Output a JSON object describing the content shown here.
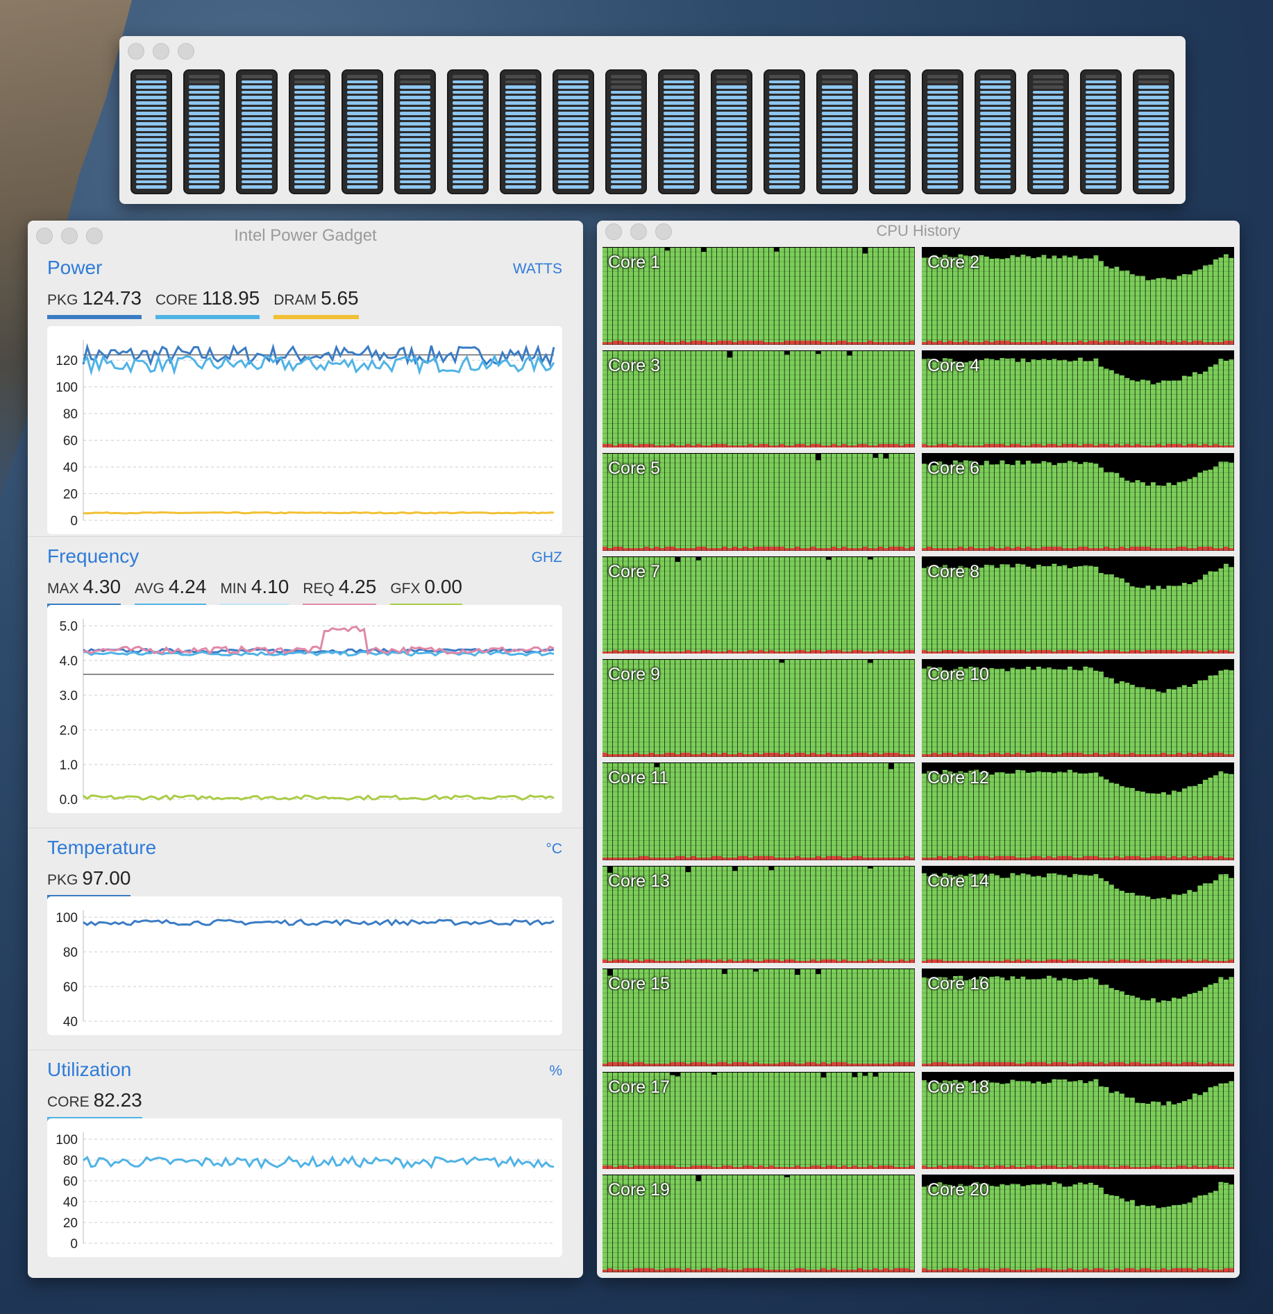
{
  "meter_window": {
    "core_count": 20,
    "levels": [
      0.97,
      0.92,
      0.97,
      0.92,
      0.97,
      0.92,
      0.97,
      0.92,
      0.97,
      0.88,
      0.97,
      0.92,
      0.97,
      0.92,
      0.97,
      0.92,
      0.97,
      0.88,
      0.97,
      0.92
    ],
    "on_color": "#8ec6f0",
    "off_color": "#4a4a4a"
  },
  "power_gadget": {
    "title": "Intel Power Gadget",
    "power": {
      "title": "Power",
      "unit": "WATTS",
      "metrics": [
        {
          "key": "PKG",
          "value": "124.73",
          "color": "#3a7cc4"
        },
        {
          "key": "CORE",
          "value": "118.95",
          "color": "#4fb3e6"
        },
        {
          "key": "DRAM",
          "value": "5.65",
          "color": "#f2c034"
        }
      ],
      "chart_data": {
        "type": "line",
        "yticks": [
          "120",
          "100",
          "80",
          "60",
          "40",
          "20",
          "0"
        ],
        "ylim": [
          0,
          130
        ],
        "ref_line": 124,
        "series": [
          {
            "key": "PKG",
            "color": "#3a7cc4",
            "base": 124,
            "jitter": 7
          },
          {
            "key": "CORE",
            "color": "#4fb3e6",
            "base": 117,
            "jitter": 6
          },
          {
            "key": "DRAM",
            "color": "#f2c034",
            "base": 5.6,
            "jitter": 0.4
          }
        ]
      }
    },
    "frequency": {
      "title": "Frequency",
      "unit": "GHZ",
      "metrics": [
        {
          "key": "MAX",
          "value": "4.30",
          "color": "#3a7cc4"
        },
        {
          "key": "AVG",
          "value": "4.24",
          "color": "#4fb3e6"
        },
        {
          "key": "MIN",
          "value": "4.10",
          "color": "#bfe3f5"
        },
        {
          "key": "REQ",
          "value": "4.25",
          "color": "#e088a8"
        },
        {
          "key": "GFX",
          "value": "0.00",
          "color": "#a9cc45"
        }
      ],
      "chart_data": {
        "type": "line",
        "yticks": [
          "5.0",
          "4.0",
          "3.0",
          "2.0",
          "1.0",
          "0.0"
        ],
        "ylim": [
          0,
          5
        ],
        "ref_line": 3.6,
        "series": [
          {
            "key": "MAX",
            "color": "#3a7cc4",
            "base": 4.28,
            "jitter": 0.05
          },
          {
            "key": "AVG",
            "color": "#4fb3e6",
            "base": 4.2,
            "jitter": 0.06
          },
          {
            "key": "REQ",
            "color": "#e088a8",
            "base": 4.3,
            "jitter": 0.1
          },
          {
            "key": "GFX",
            "color": "#a9cc45",
            "base": 0.05,
            "jitter": 0.06
          }
        ]
      }
    },
    "temperature": {
      "title": "Temperature",
      "unit": "°C",
      "metrics": [
        {
          "key": "PKG",
          "value": "97.00",
          "color": "#3a7cc4"
        }
      ],
      "chart_data": {
        "type": "line",
        "yticks": [
          "100",
          "80",
          "60",
          "40"
        ],
        "ylim": [
          40,
          100
        ],
        "series": [
          {
            "key": "PKG",
            "color": "#3a7cc4",
            "base": 97,
            "jitter": 1.5
          }
        ]
      }
    },
    "utilization": {
      "title": "Utilization",
      "unit": "%",
      "metrics": [
        {
          "key": "CORE",
          "value": "82.23",
          "color": "#4fb3e6"
        }
      ],
      "chart_data": {
        "type": "line",
        "yticks": [
          "100",
          "80",
          "60",
          "40",
          "20",
          "0"
        ],
        "ylim": [
          0,
          100
        ],
        "series": [
          {
            "key": "CORE",
            "color": "#4fb3e6",
            "base": 78,
            "jitter": 5
          }
        ]
      }
    }
  },
  "cpu_history": {
    "title": "CPU History",
    "cores": [
      {
        "label": "Core 1",
        "pattern": "flat"
      },
      {
        "label": "Core 2",
        "pattern": "dip"
      },
      {
        "label": "Core 3",
        "pattern": "flat"
      },
      {
        "label": "Core 4",
        "pattern": "dip"
      },
      {
        "label": "Core 5",
        "pattern": "flat"
      },
      {
        "label": "Core 6",
        "pattern": "dip"
      },
      {
        "label": "Core 7",
        "pattern": "flat"
      },
      {
        "label": "Core 8",
        "pattern": "dip"
      },
      {
        "label": "Core 9",
        "pattern": "flat"
      },
      {
        "label": "Core 10",
        "pattern": "dip"
      },
      {
        "label": "Core 11",
        "pattern": "flat"
      },
      {
        "label": "Core 12",
        "pattern": "dip"
      },
      {
        "label": "Core 13",
        "pattern": "flat"
      },
      {
        "label": "Core 14",
        "pattern": "dip"
      },
      {
        "label": "Core 15",
        "pattern": "flat"
      },
      {
        "label": "Core 16",
        "pattern": "dip"
      },
      {
        "label": "Core 17",
        "pattern": "flat"
      },
      {
        "label": "Core 18",
        "pattern": "dip"
      },
      {
        "label": "Core 19",
        "pattern": "flat"
      },
      {
        "label": "Core 20",
        "pattern": "dip"
      }
    ],
    "user_color": "#7ccf5a",
    "system_color": "#d8433a",
    "idle_color": "#000000"
  }
}
